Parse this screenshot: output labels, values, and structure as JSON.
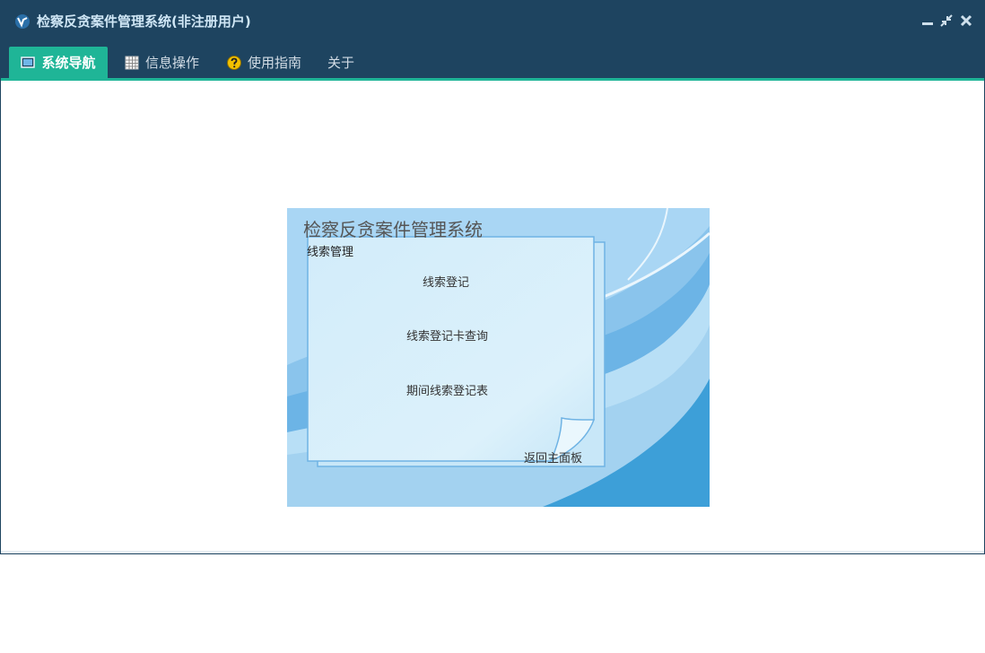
{
  "window": {
    "title": "检察反贪案件管理系统(非注册用户)"
  },
  "menu": {
    "items": [
      {
        "label": "系统导航",
        "active": true
      },
      {
        "label": "信息操作",
        "active": false
      },
      {
        "label": "使用指南",
        "active": false
      },
      {
        "label": "关于",
        "active": false
      }
    ]
  },
  "panel": {
    "title": "检察反贪案件管理系统",
    "section": "线索管理",
    "links": [
      "线索登记",
      "线索登记卡查询",
      "期间线索登记表"
    ],
    "back": "返回主面板"
  },
  "colors": {
    "titlebar": "#1e4460",
    "accent": "#1fb597",
    "panel_bg": "#a8d4f2",
    "card_bg": "#d7eefa"
  },
  "icons": {
    "app": "app-logo-icon",
    "minimize": "minimize-icon",
    "restore": "restore-icon",
    "close": "close-icon",
    "nav": "monitor-icon",
    "info": "grid-icon",
    "guide": "help-icon"
  }
}
